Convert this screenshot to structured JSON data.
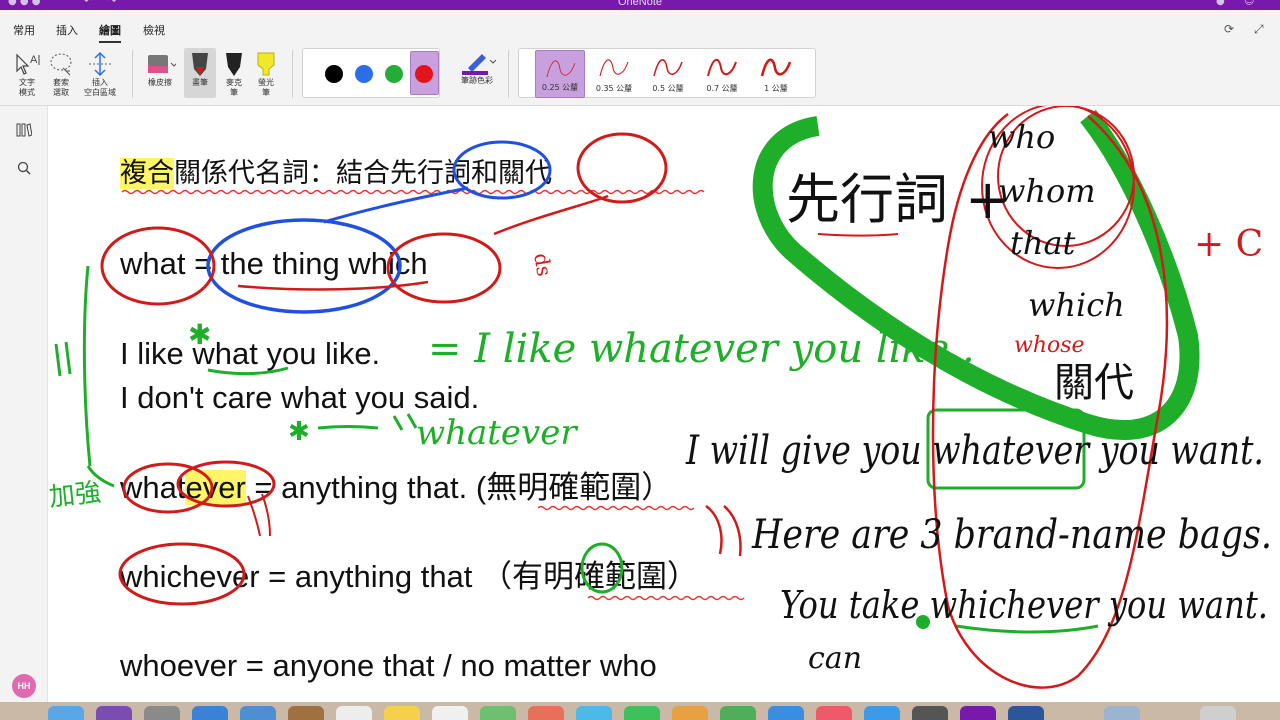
{
  "app": {
    "title": "OneNote"
  },
  "tabs": [
    {
      "label": "常用",
      "active": false
    },
    {
      "label": "插入",
      "active": false
    },
    {
      "label": "繪圖",
      "active": true
    },
    {
      "label": "檢視",
      "active": false
    }
  ],
  "ribbon": {
    "text_mode_label": "文字\n模式",
    "lasso_label": "套索\n選取",
    "insert_space_label": "插入\n空白區域",
    "eraser_label": "橡皮擦",
    "pen_label": "畫筆",
    "marker_label": "麥克\n筆",
    "highlighter_label": "螢光\n筆",
    "pen_colors": [
      "#000000",
      "#2b6fe8",
      "#23ad36",
      "#e1141c"
    ],
    "selected_color": "#e1141c",
    "ink_color_label": "筆跡色彩",
    "thickness": [
      {
        "label": "0.25 公釐",
        "selected": true
      },
      {
        "label": "0.35 公釐",
        "selected": false
      },
      {
        "label": "0.5 公釐",
        "selected": false
      },
      {
        "label": "0.7 公釐",
        "selected": false
      },
      {
        "label": "1 公釐",
        "selected": false
      }
    ]
  },
  "user": {
    "initials": "HH"
  },
  "note": {
    "title_prefix": "複合",
    "title_rest": "關係代名詞：結合先行詞和關代",
    "line_what": "what = the thing which",
    "line_like": "I like what you like.",
    "line_care": "I don't care what you said.",
    "line_whatever_a": "what",
    "line_whatever_hl": "ever",
    "line_whatever_b": " = anything that. (無明確範圍）",
    "line_whichever": "whichever = anything that （有明確範圍）",
    "line_whoever": "whoever = anyone that / no matter who"
  },
  "ink": {
    "green_like": "= I like whatever you like .",
    "green_whatever": "whatever",
    "green_jiaqiang": "加強",
    "green_star1": "✱",
    "green_star2": "✱",
    "black_antecedent": "先行詞 +",
    "black_who": "who",
    "black_whom": "whom",
    "black_that": "that",
    "black_which": "which",
    "red_whose": "whose",
    "black_guandai": "關代",
    "black_sent1": "I will give you whatever you want.",
    "black_sent2": "Here are 3 brand-name bags.",
    "black_sent3": "You take whichever you want.",
    "black_can": "can",
    "red_plus": "+ C",
    "red_ds": "ds"
  },
  "colors": {
    "title_bar": "#7719aa",
    "ink_red": "#d11a1a",
    "ink_blue": "#2050e0",
    "ink_green": "#1fae2a",
    "highlight": "#fff566"
  }
}
